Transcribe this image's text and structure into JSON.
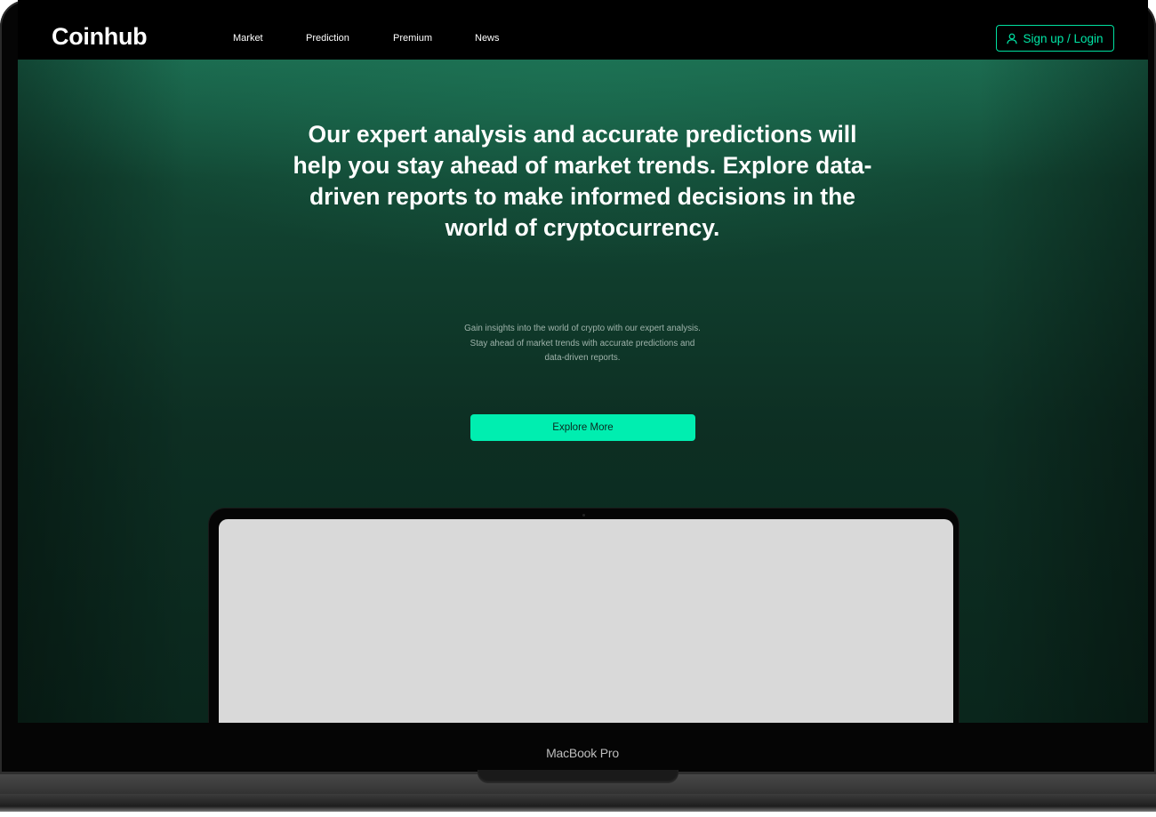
{
  "brand": {
    "logo_text": "Coinhub"
  },
  "nav": {
    "items": [
      {
        "label": "Market"
      },
      {
        "label": "Prediction"
      },
      {
        "label": "Premium"
      },
      {
        "label": "News"
      }
    ],
    "signup_label": "Sign up / Login",
    "signup_icon": "user-icon"
  },
  "hero": {
    "headline": "Our expert analysis and accurate predictions will help you stay ahead of market trends. Explore data-driven reports to make informed decisions in the world of cryptocurrency.",
    "subtext": "Gain insights into the world of crypto with our expert analysis. Stay ahead of market trends with accurate predictions and data-driven reports.",
    "cta_label": "Explore More"
  },
  "device": {
    "label": "MacBook Pro"
  },
  "colors": {
    "accent": "#00eeb0",
    "hero_green": "#1b6a4f",
    "background": "#0a261c"
  }
}
